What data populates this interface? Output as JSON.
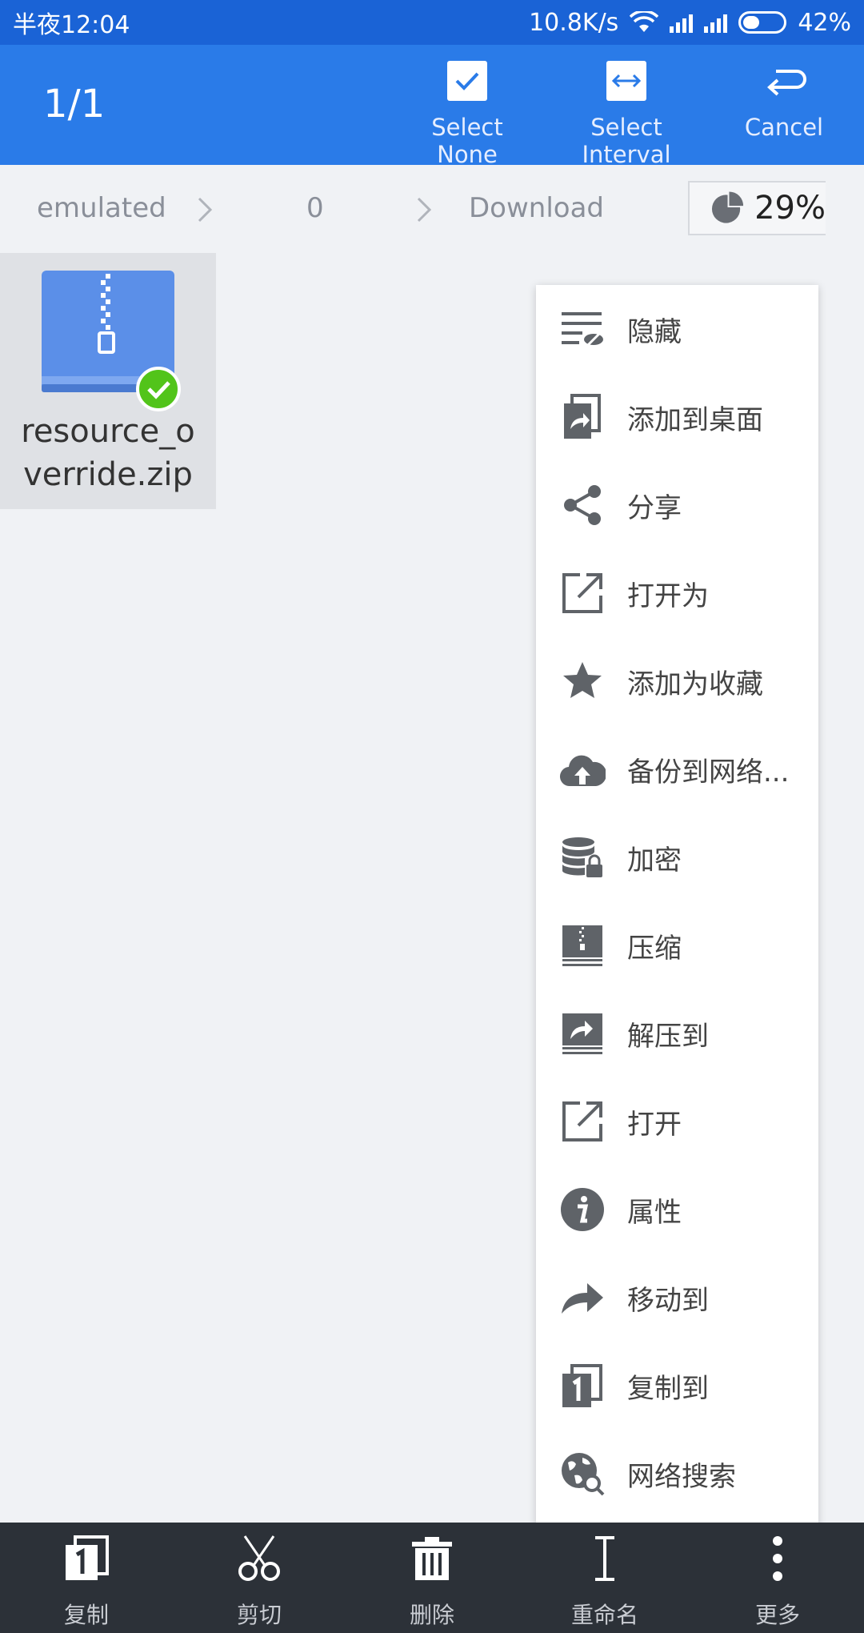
{
  "status": {
    "time": "半夜12:04",
    "speed": "10.8K/s",
    "battery": "42%"
  },
  "toolbar": {
    "count": "1/1",
    "select_none": "Select None",
    "select_interval": "Select Interval",
    "cancel": "Cancel"
  },
  "breadcrumb": {
    "items": [
      "emulated",
      "0",
      "Download"
    ],
    "storage": "29%"
  },
  "file": {
    "name_line1": "resource_o",
    "name_line2": "verride.zip"
  },
  "menu": {
    "items": [
      {
        "label": "隐藏",
        "icon": "hide-icon"
      },
      {
        "label": "添加到桌面",
        "icon": "add-to-desktop-icon"
      },
      {
        "label": "分享",
        "icon": "share-icon"
      },
      {
        "label": "打开为",
        "icon": "open-as-icon"
      },
      {
        "label": "添加为收藏",
        "icon": "star-icon"
      },
      {
        "label": "备份到网络...",
        "icon": "cloud-upload-icon"
      },
      {
        "label": "加密",
        "icon": "encrypt-icon"
      },
      {
        "label": "压缩",
        "icon": "compress-icon"
      },
      {
        "label": "解压到",
        "icon": "extract-icon"
      },
      {
        "label": "打开",
        "icon": "open-icon"
      },
      {
        "label": "属性",
        "icon": "info-icon"
      },
      {
        "label": "移动到",
        "icon": "move-icon"
      },
      {
        "label": "复制到",
        "icon": "copy-to-icon"
      },
      {
        "label": "网络搜索",
        "icon": "web-search-icon"
      }
    ]
  },
  "bottom": {
    "copy": "复制",
    "cut": "剪切",
    "delete": "删除",
    "rename": "重命名",
    "more": "更多"
  },
  "colors": {
    "status_bar": "#1a63d6",
    "toolbar": "#2a7be8",
    "bottom_bar": "#2c3138",
    "menu_icon": "#5f6368",
    "check_badge": "#52c41a",
    "zip_icon": "#5b8fe8"
  }
}
